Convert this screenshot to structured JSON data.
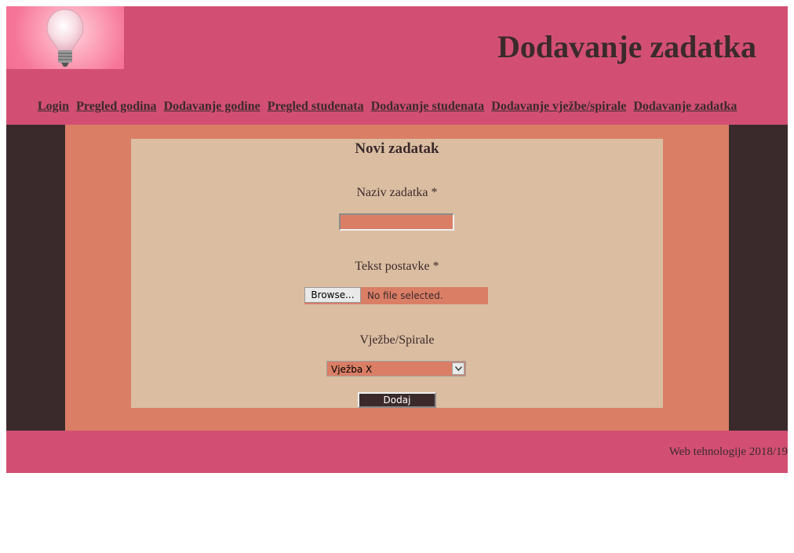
{
  "header": {
    "title": "Dodavanje zadatka",
    "logo_icon": "lightbulb-icon"
  },
  "nav": {
    "items": [
      {
        "label": "Login"
      },
      {
        "label": "Pregled godina"
      },
      {
        "label": "Dodavanje godine"
      },
      {
        "label": "Pregled studenata"
      },
      {
        "label": "Dodavanje studenata"
      },
      {
        "label": "Dodavanje vježbe/spirale"
      },
      {
        "label": "Dodavanje zadatka"
      }
    ]
  },
  "form": {
    "title": "Novi zadatak",
    "name_label": "Naziv zadatka *",
    "name_value": "",
    "file_label": "Tekst postavke *",
    "browse_label": "Browse...",
    "file_status": "No file selected.",
    "select_label": "Vježbe/Spirale",
    "select_value": "Vježba X",
    "submit_label": "Dodaj"
  },
  "footer": {
    "text": "Web tehnologije 2018/19"
  },
  "colors": {
    "header_bg": "#d24f73",
    "side_bg": "#3b2a2c",
    "center_bg": "#da7e66",
    "card_bg": "#dbbea1",
    "text": "#3b2a2c"
  }
}
